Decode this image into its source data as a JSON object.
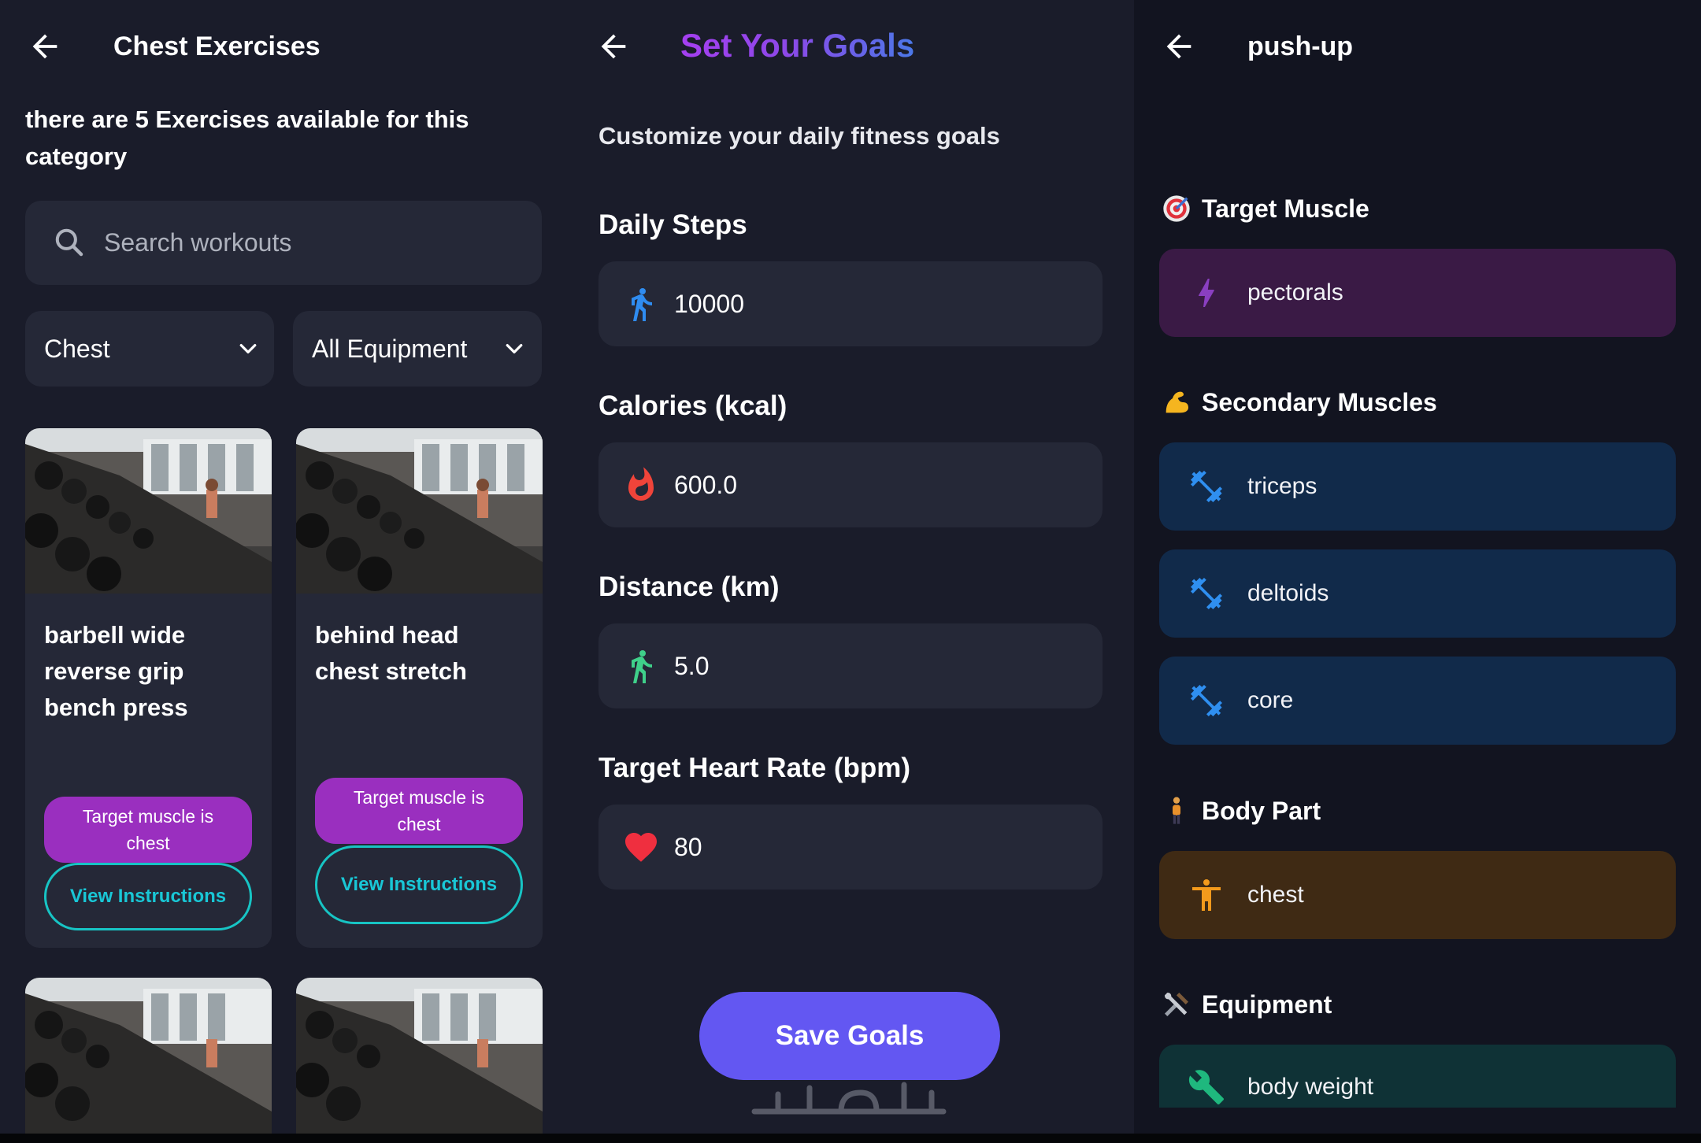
{
  "panel_exercises": {
    "title": "Chest Exercises",
    "summary": "there are 5 Exercises available for this category",
    "search": {
      "placeholder": "Search workouts",
      "value": ""
    },
    "filters": {
      "body_part": "Chest",
      "equipment": "All Equipment"
    },
    "cards": [
      {
        "name": "barbell wide reverse grip bench press",
        "target": "Target muscle is chest",
        "action": "View Instructions"
      },
      {
        "name": "behind head chest stretch",
        "target": "Target muscle is chest",
        "action": "View Instructions"
      }
    ]
  },
  "panel_goals": {
    "title": "Set Your Goals",
    "subtitle": "Customize your daily fitness goals",
    "fields": [
      {
        "label": "Daily Steps",
        "value": "10000",
        "icon": "walk-icon",
        "icon_color": "#2f8cf0"
      },
      {
        "label": "Calories (kcal)",
        "value": "600.0",
        "icon": "flame-icon",
        "icon_color": "#f0443a"
      },
      {
        "label": "Distance (km)",
        "value": "5.0",
        "icon": "walk-icon",
        "icon_color": "#3fd08a"
      },
      {
        "label": "Target Heart Rate (bpm)",
        "value": "80",
        "icon": "heart-icon",
        "icon_color": "#ef2f3f"
      }
    ],
    "save_label": "Save Goals",
    "watermark": "خمسات"
  },
  "panel_detail": {
    "title": "push-up",
    "target_heading": "Target Muscle",
    "target_muscle": "pectorals",
    "secondary_heading": "Secondary Muscles",
    "secondary_muscles": [
      "triceps",
      "deltoids",
      "core"
    ],
    "body_part_heading": "Body Part",
    "body_part": "chest",
    "equipment_heading": "Equipment",
    "equipment": "body weight"
  },
  "colors": {
    "accent_purple": "#9a2fbf",
    "accent_teal": "#19c7d6",
    "save_button": "#6357f2",
    "panel_bg": "#1a1c2a",
    "field_bg": "#252837"
  }
}
